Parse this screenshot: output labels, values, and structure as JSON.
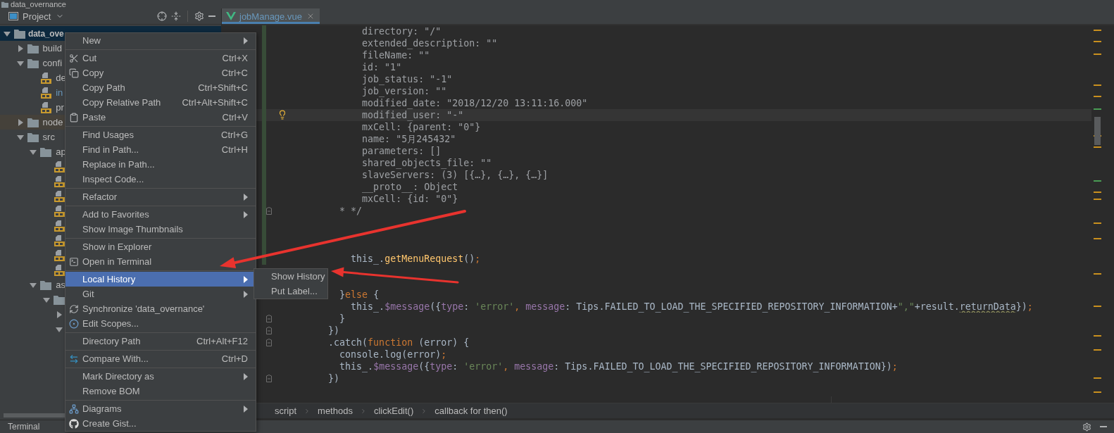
{
  "top_bar": {
    "label": "data_overnance"
  },
  "project_panel": {
    "title": "Project",
    "tree": [
      {
        "kind": "folder",
        "label": "data_ove",
        "expanded": true,
        "selected": true,
        "children": [
          {
            "kind": "folder",
            "label": "build",
            "expanded": false,
            "selected": false,
            "excluded": false
          },
          {
            "kind": "folder",
            "label": "confi",
            "expanded": true,
            "selected": false,
            "excluded": false,
            "children": [
              {
                "kind": "file",
                "label": "de",
                "selected": false,
                "modified": false
              },
              {
                "kind": "file",
                "label": "in",
                "selected": false,
                "modified": true
              },
              {
                "kind": "file",
                "label": "pr",
                "selected": false,
                "modified": false
              }
            ]
          },
          {
            "kind": "folder",
            "label": "node",
            "expanded": false,
            "selected": false,
            "excluded": true
          },
          {
            "kind": "folder",
            "label": "src",
            "expanded": true,
            "selected": false,
            "excluded": false,
            "children": [
              {
                "kind": "folder",
                "label": "ap",
                "expanded": true,
                "selected": false,
                "children": [
                  {
                    "kind": "file",
                    "selected": false
                  },
                  {
                    "kind": "file",
                    "selected": false
                  },
                  {
                    "kind": "file",
                    "selected": false
                  },
                  {
                    "kind": "file",
                    "selected": false
                  },
                  {
                    "kind": "file",
                    "selected": false
                  },
                  {
                    "kind": "file",
                    "selected": false
                  },
                  {
                    "kind": "file",
                    "selected": false
                  },
                  {
                    "kind": "file",
                    "selected": false
                  }
                ]
              },
              {
                "kind": "folder",
                "label": "as",
                "expanded": true,
                "selected": false,
                "children": [
                  {
                    "kind": "folder",
                    "expanded": true,
                    "selected": false,
                    "children": [
                      {
                        "kind": "folder",
                        "expanded": false,
                        "selected": false
                      },
                      {
                        "kind": "folder",
                        "expanded": true,
                        "selected": false
                      }
                    ]
                  }
                ]
              }
            ]
          }
        ]
      }
    ]
  },
  "editor": {
    "tabs": [
      {
        "label": "jobManage.vue",
        "selected": true
      }
    ],
    "lines": [
      {
        "kind": "code",
        "changed": true,
        "current": false,
        "fold": false,
        "tokens": [
          {
            "kind": "comment",
            "text": "                directory: \"/\""
          }
        ]
      },
      {
        "kind": "code",
        "changed": true,
        "current": false,
        "fold": false,
        "tokens": [
          {
            "kind": "comment",
            "text": "                extended_description: \"\""
          }
        ]
      },
      {
        "kind": "code",
        "changed": true,
        "current": false,
        "fold": false,
        "tokens": [
          {
            "kind": "comment",
            "text": "                fileName: \"\""
          }
        ]
      },
      {
        "kind": "code",
        "changed": true,
        "current": false,
        "fold": false,
        "tokens": [
          {
            "kind": "comment",
            "text": "                id: \"1\""
          }
        ]
      },
      {
        "kind": "code",
        "changed": true,
        "current": false,
        "fold": false,
        "tokens": [
          {
            "kind": "comment",
            "text": "                job_status: \"-1\""
          }
        ]
      },
      {
        "kind": "code",
        "changed": true,
        "current": false,
        "fold": false,
        "tokens": [
          {
            "kind": "comment",
            "text": "                job_version: \"\""
          }
        ]
      },
      {
        "kind": "code",
        "changed": true,
        "current": false,
        "fold": false,
        "tokens": [
          {
            "kind": "comment",
            "text": "                modified_date: \"2018/12/20 13:11:16.000\""
          }
        ]
      },
      {
        "kind": "code",
        "changed": true,
        "current": true,
        "fold": false,
        "tokens": [
          {
            "kind": "comment",
            "text": "                modified_user: \"-\""
          }
        ]
      },
      {
        "kind": "code",
        "changed": true,
        "current": false,
        "fold": false,
        "tokens": [
          {
            "kind": "comment",
            "text": "                mxCell: {parent: \"0\"}"
          }
        ]
      },
      {
        "kind": "code",
        "changed": true,
        "current": false,
        "fold": false,
        "tokens": [
          {
            "kind": "comment",
            "text": "                name: \"5月245432\""
          }
        ]
      },
      {
        "kind": "code",
        "changed": true,
        "current": false,
        "fold": false,
        "tokens": [
          {
            "kind": "comment",
            "text": "                parameters: []"
          }
        ]
      },
      {
        "kind": "code",
        "changed": true,
        "current": false,
        "fold": false,
        "tokens": [
          {
            "kind": "comment",
            "text": "                shared_objects_file: \"\""
          }
        ]
      },
      {
        "kind": "code",
        "changed": true,
        "current": false,
        "fold": false,
        "tokens": [
          {
            "kind": "comment",
            "text": "                slaveServers: (3) [{…}, {…}, {…}]"
          }
        ]
      },
      {
        "kind": "code",
        "changed": true,
        "current": false,
        "fold": false,
        "tokens": [
          {
            "kind": "comment",
            "text": "                __proto__: Object"
          }
        ]
      },
      {
        "kind": "code",
        "changed": true,
        "current": false,
        "fold": false,
        "tokens": [
          {
            "kind": "comment",
            "text": "                mxCell: {id: \"0\"}"
          }
        ]
      },
      {
        "kind": "code",
        "changed": true,
        "current": false,
        "fold": true,
        "tokens": [
          {
            "kind": "comment",
            "text": "            * */"
          }
        ]
      },
      {
        "kind": "blank",
        "changed": true,
        "current": false,
        "fold": false
      },
      {
        "kind": "blank",
        "changed": true,
        "current": false,
        "fold": false
      },
      {
        "kind": "blank",
        "changed": true,
        "current": false,
        "fold": false
      },
      {
        "kind": "code",
        "changed": true,
        "current": false,
        "fold": false,
        "tokens": [
          {
            "kind": "plain",
            "text": "              this_."
          },
          {
            "kind": "method",
            "text": "getMenuRequest"
          },
          {
            "kind": "plain",
            "text": "()"
          },
          {
            "kind": "punct",
            "text": ";"
          }
        ]
      },
      {
        "kind": "blank",
        "changed": false,
        "current": false,
        "fold": false
      },
      {
        "kind": "blank"
      },
      {
        "kind": "code",
        "changed": false,
        "tokens": [
          {
            "kind": "plain",
            "text": "            }"
          },
          {
            "kind": "keyword",
            "text": "else"
          },
          {
            "kind": "plain",
            "text": " {"
          }
        ]
      },
      {
        "kind": "code",
        "changed": false,
        "current": false,
        "fold": false,
        "tokens": [
          {
            "kind": "plain",
            "text": "              this_."
          },
          {
            "kind": "field",
            "text": "$message"
          },
          {
            "kind": "plain",
            "text": "({"
          },
          {
            "kind": "field",
            "text": "type"
          },
          {
            "kind": "plain",
            "text": ": "
          },
          {
            "kind": "string",
            "text": "'error'"
          },
          {
            "kind": "punct",
            "text": ", "
          },
          {
            "kind": "field",
            "text": "message"
          },
          {
            "kind": "plain",
            "text": ": Tips.FAILED_TO_LOAD_THE_SPECIFIED_REPOSITORY_INFORMATION+"
          },
          {
            "kind": "string",
            "text": "\",\""
          },
          {
            "kind": "plain",
            "text": "+result."
          },
          {
            "kind": "warn",
            "text": "returnData"
          },
          {
            "kind": "plain",
            "text": "})"
          },
          {
            "kind": "punct",
            "text": ";"
          }
        ]
      },
      {
        "kind": "code",
        "changed": false,
        "current": false,
        "fold": true,
        "tokens": [
          {
            "kind": "plain",
            "text": "            }"
          }
        ]
      },
      {
        "kind": "code",
        "changed": false,
        "current": false,
        "fold": true,
        "tokens": [
          {
            "kind": "plain",
            "text": "          })"
          }
        ]
      },
      {
        "kind": "code",
        "changed": false,
        "current": false,
        "fold": true,
        "tokens": [
          {
            "kind": "plain",
            "text": "          .catch("
          },
          {
            "kind": "keyword",
            "text": "function"
          },
          {
            "kind": "plain",
            "text": " (error) {"
          }
        ]
      },
      {
        "kind": "code",
        "changed": false,
        "current": false,
        "fold": false,
        "tokens": [
          {
            "kind": "plain",
            "text": "            console.log(error)"
          },
          {
            "kind": "punct",
            "text": ";"
          }
        ]
      },
      {
        "kind": "code",
        "changed": false,
        "current": false,
        "fold": false,
        "tokens": [
          {
            "kind": "plain",
            "text": "            this_."
          },
          {
            "kind": "field",
            "text": "$message"
          },
          {
            "kind": "plain",
            "text": "({"
          },
          {
            "kind": "field",
            "text": "type"
          },
          {
            "kind": "plain",
            "text": ": "
          },
          {
            "kind": "string",
            "text": "'error'"
          },
          {
            "kind": "punct",
            "text": ", "
          },
          {
            "kind": "field",
            "text": "message"
          },
          {
            "kind": "plain",
            "text": ": Tips.FAILED_TO_LOAD_THE_SPECIFIED_REPOSITORY_INFORMATION})"
          },
          {
            "kind": "punct",
            "text": ";"
          }
        ]
      },
      {
        "kind": "code",
        "changed": false,
        "current": false,
        "fold": true,
        "tokens": [
          {
            "kind": "plain",
            "text": "          })"
          }
        ]
      },
      {
        "kind": "blank",
        "changed": false,
        "current": false,
        "fold": false
      }
    ],
    "breadcrumbs": [
      "script",
      "methods",
      "clickEdit()",
      "callback for then()"
    ]
  },
  "context_menu": {
    "items": [
      {
        "kind": "item",
        "label": "New",
        "submenu": true,
        "selected": false
      },
      {
        "kind": "separator"
      },
      {
        "kind": "item",
        "label": "Cut",
        "shortcut": "Ctrl+X",
        "submenu": false,
        "selected": false
      },
      {
        "kind": "item",
        "label": "Copy",
        "shortcut": "Ctrl+C",
        "submenu": false,
        "selected": false
      },
      {
        "kind": "item",
        "label": "Copy Path",
        "shortcut": "Ctrl+Shift+C",
        "submenu": false,
        "selected": false
      },
      {
        "kind": "item",
        "label": "Copy Relative Path",
        "shortcut": "Ctrl+Alt+Shift+C",
        "submenu": false,
        "selected": false
      },
      {
        "kind": "item",
        "label": "Paste",
        "shortcut": "Ctrl+V",
        "submenu": false,
        "selected": false
      },
      {
        "kind": "separator"
      },
      {
        "kind": "item",
        "label": "Find Usages",
        "shortcut": "Ctrl+G",
        "submenu": false,
        "selected": false
      },
      {
        "kind": "item",
        "label": "Find in Path...",
        "shortcut": "Ctrl+H",
        "submenu": false,
        "selected": false
      },
      {
        "kind": "item",
        "label": "Replace in Path...",
        "submenu": false,
        "selected": false
      },
      {
        "kind": "item",
        "label": "Inspect Code...",
        "submenu": false,
        "selected": false
      },
      {
        "kind": "separator"
      },
      {
        "kind": "item",
        "label": "Refactor",
        "submenu": true,
        "selected": false
      },
      {
        "kind": "separator"
      },
      {
        "kind": "item",
        "label": "Add to Favorites",
        "submenu": true,
        "selected": false
      },
      {
        "kind": "item",
        "label": "Show Image Thumbnails",
        "submenu": false,
        "selected": false
      },
      {
        "kind": "separator"
      },
      {
        "kind": "item",
        "label": "Show in Explorer",
        "submenu": false,
        "selected": false
      },
      {
        "kind": "item",
        "label": "Open in Terminal",
        "submenu": false,
        "selected": false
      },
      {
        "kind": "separator"
      },
      {
        "kind": "item",
        "label": "Local History",
        "submenu": true,
        "selected": true
      },
      {
        "kind": "item",
        "label": "Git",
        "submenu": true,
        "selected": false
      },
      {
        "kind": "item",
        "label": "Synchronize 'data_overnance'",
        "submenu": false,
        "selected": false
      },
      {
        "kind": "item",
        "label": "Edit Scopes...",
        "submenu": false,
        "selected": false
      },
      {
        "kind": "separator"
      },
      {
        "kind": "item",
        "label": "Directory Path",
        "shortcut": "Ctrl+Alt+F12",
        "submenu": false,
        "selected": false
      },
      {
        "kind": "separator"
      },
      {
        "kind": "item",
        "label": "Compare With...",
        "shortcut": "Ctrl+D",
        "submenu": false,
        "selected": false
      },
      {
        "kind": "separator"
      },
      {
        "kind": "item",
        "label": "Mark Directory as",
        "submenu": true,
        "selected": false
      },
      {
        "kind": "item",
        "label": "Remove BOM",
        "submenu": false,
        "selected": false
      },
      {
        "kind": "separator"
      },
      {
        "kind": "item",
        "label": "Diagrams",
        "submenu": true,
        "selected": false
      },
      {
        "kind": "item",
        "label": "Create Gist...",
        "submenu": false,
        "selected": false
      }
    ]
  },
  "submenu": {
    "items": [
      {
        "label": "Show History",
        "selected": false
      },
      {
        "label": "Put Label...",
        "selected": false
      }
    ]
  },
  "bottom_bar": {
    "label": "Terminal"
  },
  "annotations": [
    {
      "kind": "arrow"
    },
    {
      "kind": "arrow"
    }
  ]
}
